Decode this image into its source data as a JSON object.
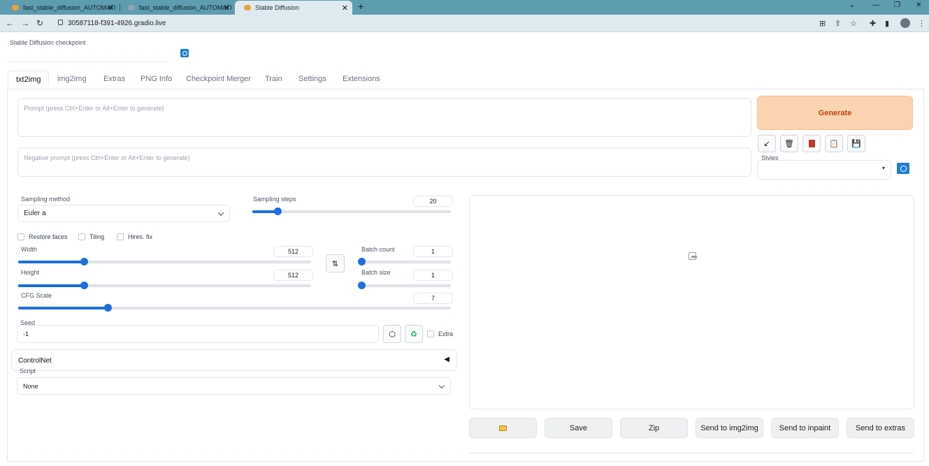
{
  "browser": {
    "tabs": [
      {
        "title": "fast_stable_diffusion_AUTOMATI"
      },
      {
        "title": "fast_stable_diffusion_AUTOMATI"
      },
      {
        "title": "Stable Diffusion"
      }
    ],
    "url": "30587118-f391-4926.gradio.live"
  },
  "checkpoint": {
    "label": "Stable Diffusion checkpoint",
    "value": ""
  },
  "main_tabs": [
    "txt2img",
    "img2img",
    "Extras",
    "PNG Info",
    "Checkpoint Merger",
    "Train",
    "Settings",
    "Extensions"
  ],
  "prompt": {
    "placeholder": "Prompt (press Ctrl+Enter or Alt+Enter to generate)"
  },
  "negative_prompt": {
    "placeholder": "Negative prompt (press Ctrl+Enter or Alt+Enter to generate)"
  },
  "generate_label": "Generate",
  "styles": {
    "label": "Styles",
    "value": ""
  },
  "sampling": {
    "method_label": "Sampling method",
    "method_value": "Euler a",
    "steps_label": "Sampling steps",
    "steps_value": "20",
    "steps_min": 1,
    "steps_max": 150
  },
  "checkboxes": {
    "restore_faces": "Restore faces",
    "tiling": "Tiling",
    "hires_fix": "Hires. fix",
    "extra": "Extra"
  },
  "width": {
    "label": "Width",
    "value": "512",
    "min": 64,
    "max": 2048
  },
  "height": {
    "label": "Height",
    "value": "512",
    "min": 64,
    "max": 2048
  },
  "batch_count": {
    "label": "Batch count",
    "value": "1",
    "min": 1,
    "max": 100
  },
  "batch_size": {
    "label": "Batch size",
    "value": "1",
    "min": 1,
    "max": 8
  },
  "cfg_scale": {
    "label": "CFG Scale",
    "value": "7",
    "min": 1,
    "max": 30
  },
  "seed": {
    "label": "Seed",
    "value": "-1"
  },
  "controlnet": {
    "label": "ControlNet"
  },
  "script": {
    "label": "Script",
    "value": "None"
  },
  "actions": {
    "save": "Save",
    "zip": "Zip",
    "send_img2img": "Send to img2img",
    "send_inpaint": "Send to inpaint",
    "send_extras": "Send to extras"
  },
  "colors": {
    "accent": "#1c6fe0",
    "generate_bg": "#fbd3b1",
    "generate_text": "#c2410c",
    "tabbar": "#5e9cb0"
  }
}
